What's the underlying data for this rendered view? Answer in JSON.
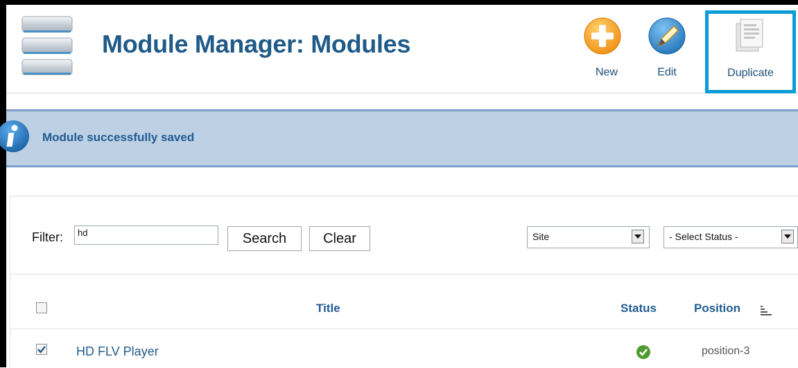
{
  "header": {
    "title": "Module Manager: Modules",
    "icon": "module-stack-icon"
  },
  "toolbar": {
    "new_label": "New",
    "edit_label": "Edit",
    "duplicate_label": "Duplicate"
  },
  "message": {
    "text": "Module successfully saved",
    "icon": "info-icon"
  },
  "filter": {
    "label": "Filter:",
    "value": "hd",
    "search_label": "Search",
    "clear_label": "Clear",
    "client_select": "Site",
    "status_select": "- Select Status -"
  },
  "table": {
    "columns": [
      "Title",
      "Status",
      "Position"
    ],
    "rows": [
      {
        "title": "HD FLV Player",
        "checked": true,
        "status": "published",
        "position": "position-3"
      }
    ]
  },
  "colors": {
    "accent": "#1f5a88",
    "message_bg": "#bdd0e4",
    "highlight_border": "#0b9bd6",
    "published": "#4f9a2f"
  }
}
